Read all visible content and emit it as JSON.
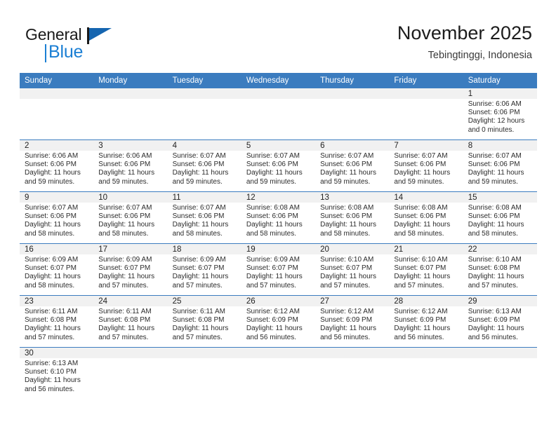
{
  "brand": {
    "name_part1": "General",
    "name_part2": "Blue",
    "logo_icon": "flag-triangle-icon"
  },
  "header": {
    "title": "November 2025",
    "subtitle": "Tebingtinggi, Indonesia"
  },
  "calendar": {
    "weekday_headers": [
      "Sunday",
      "Monday",
      "Tuesday",
      "Wednesday",
      "Thursday",
      "Friday",
      "Saturday"
    ],
    "accent_color": "#3b7cbf",
    "daynum_band_color": "#f1f1f1",
    "weeks": [
      [
        {
          "day": "",
          "lines": []
        },
        {
          "day": "",
          "lines": []
        },
        {
          "day": "",
          "lines": []
        },
        {
          "day": "",
          "lines": []
        },
        {
          "day": "",
          "lines": []
        },
        {
          "day": "",
          "lines": []
        },
        {
          "day": "1",
          "lines": [
            "Sunrise: 6:06 AM",
            "Sunset: 6:06 PM",
            "Daylight: 12 hours",
            "and 0 minutes."
          ]
        }
      ],
      [
        {
          "day": "2",
          "lines": [
            "Sunrise: 6:06 AM",
            "Sunset: 6:06 PM",
            "Daylight: 11 hours",
            "and 59 minutes."
          ]
        },
        {
          "day": "3",
          "lines": [
            "Sunrise: 6:06 AM",
            "Sunset: 6:06 PM",
            "Daylight: 11 hours",
            "and 59 minutes."
          ]
        },
        {
          "day": "4",
          "lines": [
            "Sunrise: 6:07 AM",
            "Sunset: 6:06 PM",
            "Daylight: 11 hours",
            "and 59 minutes."
          ]
        },
        {
          "day": "5",
          "lines": [
            "Sunrise: 6:07 AM",
            "Sunset: 6:06 PM",
            "Daylight: 11 hours",
            "and 59 minutes."
          ]
        },
        {
          "day": "6",
          "lines": [
            "Sunrise: 6:07 AM",
            "Sunset: 6:06 PM",
            "Daylight: 11 hours",
            "and 59 minutes."
          ]
        },
        {
          "day": "7",
          "lines": [
            "Sunrise: 6:07 AM",
            "Sunset: 6:06 PM",
            "Daylight: 11 hours",
            "and 59 minutes."
          ]
        },
        {
          "day": "8",
          "lines": [
            "Sunrise: 6:07 AM",
            "Sunset: 6:06 PM",
            "Daylight: 11 hours",
            "and 59 minutes."
          ]
        }
      ],
      [
        {
          "day": "9",
          "lines": [
            "Sunrise: 6:07 AM",
            "Sunset: 6:06 PM",
            "Daylight: 11 hours",
            "and 58 minutes."
          ]
        },
        {
          "day": "10",
          "lines": [
            "Sunrise: 6:07 AM",
            "Sunset: 6:06 PM",
            "Daylight: 11 hours",
            "and 58 minutes."
          ]
        },
        {
          "day": "11",
          "lines": [
            "Sunrise: 6:07 AM",
            "Sunset: 6:06 PM",
            "Daylight: 11 hours",
            "and 58 minutes."
          ]
        },
        {
          "day": "12",
          "lines": [
            "Sunrise: 6:08 AM",
            "Sunset: 6:06 PM",
            "Daylight: 11 hours",
            "and 58 minutes."
          ]
        },
        {
          "day": "13",
          "lines": [
            "Sunrise: 6:08 AM",
            "Sunset: 6:06 PM",
            "Daylight: 11 hours",
            "and 58 minutes."
          ]
        },
        {
          "day": "14",
          "lines": [
            "Sunrise: 6:08 AM",
            "Sunset: 6:06 PM",
            "Daylight: 11 hours",
            "and 58 minutes."
          ]
        },
        {
          "day": "15",
          "lines": [
            "Sunrise: 6:08 AM",
            "Sunset: 6:06 PM",
            "Daylight: 11 hours",
            "and 58 minutes."
          ]
        }
      ],
      [
        {
          "day": "16",
          "lines": [
            "Sunrise: 6:09 AM",
            "Sunset: 6:07 PM",
            "Daylight: 11 hours",
            "and 58 minutes."
          ]
        },
        {
          "day": "17",
          "lines": [
            "Sunrise: 6:09 AM",
            "Sunset: 6:07 PM",
            "Daylight: 11 hours",
            "and 57 minutes."
          ]
        },
        {
          "day": "18",
          "lines": [
            "Sunrise: 6:09 AM",
            "Sunset: 6:07 PM",
            "Daylight: 11 hours",
            "and 57 minutes."
          ]
        },
        {
          "day": "19",
          "lines": [
            "Sunrise: 6:09 AM",
            "Sunset: 6:07 PM",
            "Daylight: 11 hours",
            "and 57 minutes."
          ]
        },
        {
          "day": "20",
          "lines": [
            "Sunrise: 6:10 AM",
            "Sunset: 6:07 PM",
            "Daylight: 11 hours",
            "and 57 minutes."
          ]
        },
        {
          "day": "21",
          "lines": [
            "Sunrise: 6:10 AM",
            "Sunset: 6:07 PM",
            "Daylight: 11 hours",
            "and 57 minutes."
          ]
        },
        {
          "day": "22",
          "lines": [
            "Sunrise: 6:10 AM",
            "Sunset: 6:08 PM",
            "Daylight: 11 hours",
            "and 57 minutes."
          ]
        }
      ],
      [
        {
          "day": "23",
          "lines": [
            "Sunrise: 6:11 AM",
            "Sunset: 6:08 PM",
            "Daylight: 11 hours",
            "and 57 minutes."
          ]
        },
        {
          "day": "24",
          "lines": [
            "Sunrise: 6:11 AM",
            "Sunset: 6:08 PM",
            "Daylight: 11 hours",
            "and 57 minutes."
          ]
        },
        {
          "day": "25",
          "lines": [
            "Sunrise: 6:11 AM",
            "Sunset: 6:08 PM",
            "Daylight: 11 hours",
            "and 57 minutes."
          ]
        },
        {
          "day": "26",
          "lines": [
            "Sunrise: 6:12 AM",
            "Sunset: 6:09 PM",
            "Daylight: 11 hours",
            "and 56 minutes."
          ]
        },
        {
          "day": "27",
          "lines": [
            "Sunrise: 6:12 AM",
            "Sunset: 6:09 PM",
            "Daylight: 11 hours",
            "and 56 minutes."
          ]
        },
        {
          "day": "28",
          "lines": [
            "Sunrise: 6:12 AM",
            "Sunset: 6:09 PM",
            "Daylight: 11 hours",
            "and 56 minutes."
          ]
        },
        {
          "day": "29",
          "lines": [
            "Sunrise: 6:13 AM",
            "Sunset: 6:09 PM",
            "Daylight: 11 hours",
            "and 56 minutes."
          ]
        }
      ],
      [
        {
          "day": "30",
          "lines": [
            "Sunrise: 6:13 AM",
            "Sunset: 6:10 PM",
            "Daylight: 11 hours",
            "and 56 minutes."
          ]
        },
        {
          "day": "",
          "lines": []
        },
        {
          "day": "",
          "lines": []
        },
        {
          "day": "",
          "lines": []
        },
        {
          "day": "",
          "lines": []
        },
        {
          "day": "",
          "lines": []
        },
        {
          "day": "",
          "lines": []
        }
      ]
    ]
  }
}
